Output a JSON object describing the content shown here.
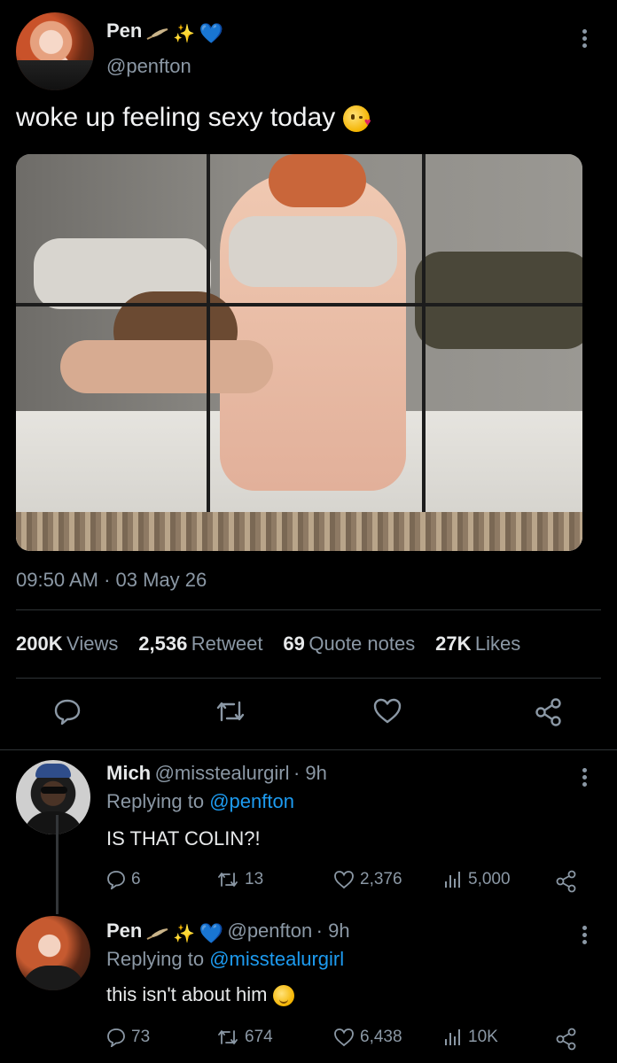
{
  "tweet": {
    "author_name": "Pen",
    "author_handle": "@penfton",
    "text": "woke up feeling sexy today",
    "sparkle_glyph": "✨",
    "blue_heart_glyph": "💙",
    "timestamp": "09:50 AM",
    "date": "03 May 26"
  },
  "stats": {
    "views_num": "200K",
    "views_label": "Views",
    "retweets_num": "2,536",
    "retweets_label": "Retweet",
    "quotes_num": "69",
    "quotes_label": "Quote notes",
    "likes_num": "27K",
    "likes_label": "Likes"
  },
  "actions": [
    "comment-icon",
    "retweet-icon",
    "heart-icon",
    "share-icon"
  ],
  "replies": [
    {
      "name": "Mich",
      "handle": "@misstealurgirl",
      "time": "· 9h",
      "replying_prefix": "Replying to",
      "replying_to": "@penfton",
      "text": "IS THAT COLIN?!",
      "comments": "6",
      "retweets": "13",
      "likes": "2,376",
      "views": "5,000"
    },
    {
      "name": "Pen",
      "handle": "@penfton",
      "time": "· 9h",
      "replying_prefix": "Replying to",
      "replying_to": "@misstealurgirl",
      "text": "this isn't about him",
      "comments": "73",
      "retweets": "674",
      "likes": "6,438",
      "views": "10K"
    }
  ],
  "colors": {
    "background": "#000000",
    "text_primary": "#e7e9ea",
    "text_secondary": "#8b98a5",
    "link": "#1d9bf0",
    "divider": "#2f3336"
  }
}
